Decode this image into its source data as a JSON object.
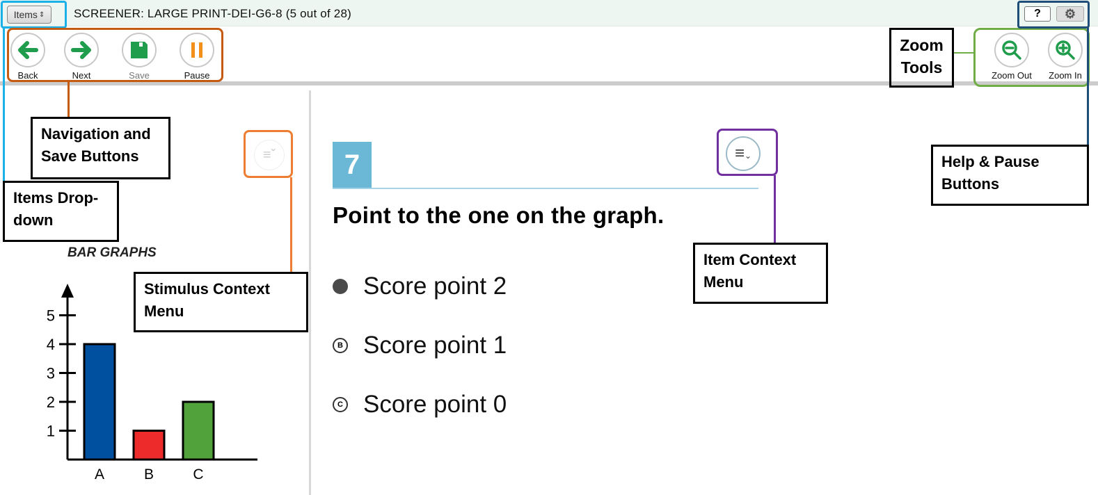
{
  "header": {
    "items_dropdown_label": "Items",
    "title": "SCREENER: LARGE PRINT-DEI-G6-8 (5 out of 28)",
    "help_label": "?",
    "settings_icon": "gear-icon"
  },
  "toolbar": {
    "back": "Back",
    "next": "Next",
    "save": "Save",
    "pause": "Pause",
    "zoom_out": "Zoom Out",
    "zoom_in": "Zoom In"
  },
  "stimulus": {
    "menu_icon": "context-menu-icon",
    "chart_data": {
      "type": "bar",
      "title": "BAR GRAPHS",
      "categories": [
        "A",
        "B",
        "C"
      ],
      "values": [
        4,
        1,
        2
      ],
      "colors": [
        "#0050a0",
        "#ee2b2b",
        "#52a23c"
      ],
      "yticks": [
        1,
        2,
        3,
        4,
        5
      ],
      "ylim": [
        0,
        5.8
      ]
    }
  },
  "item": {
    "number": "7",
    "question": "Point to the one on the graph.",
    "options": [
      {
        "letter": "A",
        "label": "Score point 2",
        "selected": true
      },
      {
        "letter": "B",
        "label": "Score point 1",
        "selected": false
      },
      {
        "letter": "C",
        "label": "Score point 0",
        "selected": false
      }
    ]
  },
  "callouts": {
    "items": "Items Drop-down",
    "navigation": "Navigation and Save Buttons",
    "stimulus_menu": "Stimulus Context Menu",
    "item_menu": "Item Context Menu",
    "zoom": "Zoom Tools",
    "help": "Help & Pause Buttons"
  },
  "colors": {
    "accent_green": "#1f9d4c",
    "pause_orange": "#f39019",
    "item_number_bg": "#6bb8d6"
  }
}
